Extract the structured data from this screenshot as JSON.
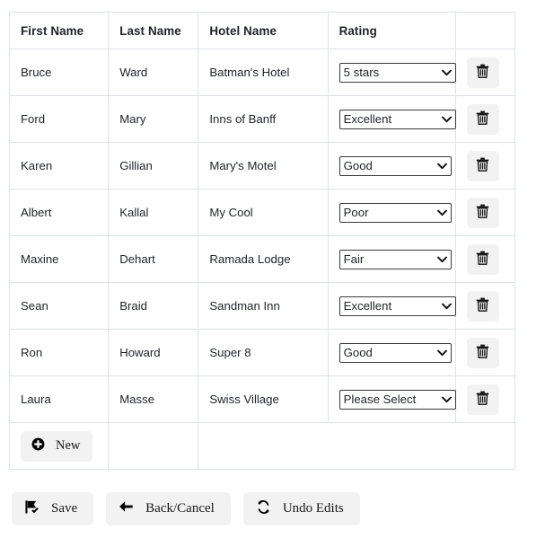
{
  "table": {
    "columns": [
      {
        "key": "first_name",
        "label": "First Name"
      },
      {
        "key": "last_name",
        "label": "Last Name"
      },
      {
        "key": "hotel_name",
        "label": "Hotel Name"
      },
      {
        "key": "rating",
        "label": "Rating"
      },
      {
        "key": "actions",
        "label": ""
      }
    ],
    "rows": [
      {
        "first_name": "Bruce",
        "last_name": "Ward",
        "hotel_name": "Batman's Hotel",
        "rating": "5 stars",
        "delete_icon": "trash-icon"
      },
      {
        "first_name": "Ford",
        "last_name": "Mary",
        "hotel_name": "Inns of Banff",
        "rating": "Excellent",
        "delete_icon": "trash-icon"
      },
      {
        "first_name": "Karen",
        "last_name": "Gillian",
        "hotel_name": "Mary's Motel",
        "rating": "Good",
        "delete_icon": "trash-icon"
      },
      {
        "first_name": "Albert",
        "last_name": "Kallal",
        "hotel_name": "My Cool",
        "rating": "Poor",
        "delete_icon": "trash-icon"
      },
      {
        "first_name": "Maxine",
        "last_name": "Dehart",
        "hotel_name": "Ramada Lodge",
        "rating": "Fair",
        "delete_icon": "trash-icon"
      },
      {
        "first_name": "Sean",
        "last_name": "Braid",
        "hotel_name": "Sandman Inn",
        "rating": "Excellent",
        "delete_icon": "trash-icon"
      },
      {
        "first_name": "Ron",
        "last_name": "Howard",
        "hotel_name": "Super 8",
        "rating": "Good",
        "delete_icon": "trash-icon"
      },
      {
        "first_name": "Laura",
        "last_name": "Masse",
        "hotel_name": "Swiss Village",
        "rating": "Please Select",
        "delete_icon": "trash-icon"
      }
    ],
    "rating_options": [
      "Please Select",
      "5 stars",
      "Excellent",
      "Good",
      "Fair",
      "Poor"
    ],
    "new_row": {
      "label": "New",
      "icon": "plus-circle-icon"
    }
  },
  "footer": {
    "buttons": [
      {
        "label": "Save",
        "icon": "save-flag-check-icon"
      },
      {
        "label": "Back/Cancel",
        "icon": "arrow-left-icon"
      },
      {
        "label": "Undo  Edits",
        "icon": "refresh-circular-arrows-icon"
      }
    ]
  },
  "colors": {
    "page_background": "#ffffff",
    "table_border": "#dee2e6",
    "text": "#212529",
    "button_background": "#f2f2f2",
    "select_border": "#3a3a3a"
  }
}
